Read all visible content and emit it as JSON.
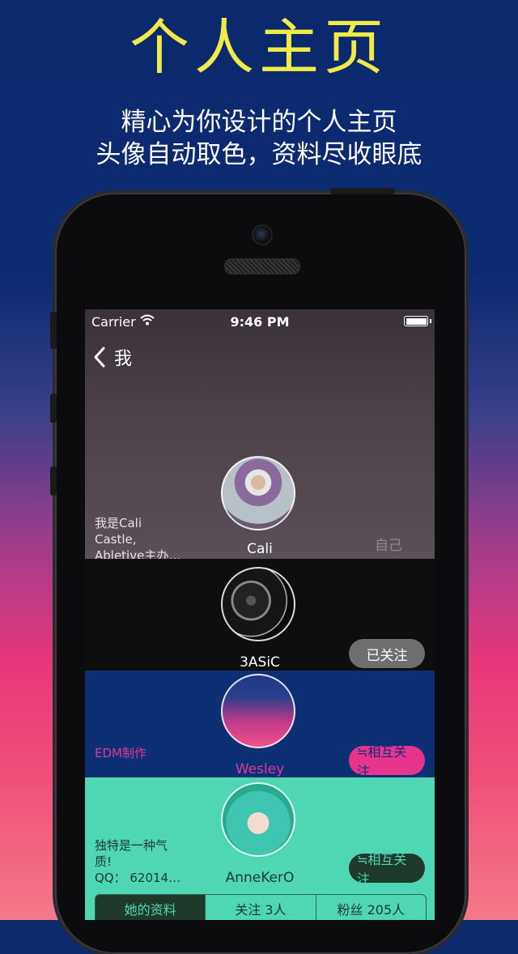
{
  "promo": {
    "title": "个人主页",
    "subtitle_line1": "精心为你设计的个人主页",
    "subtitle_line2": "头像自动取色，资料尽收眼底"
  },
  "status_bar": {
    "carrier": "Carrier",
    "time": "9:46 PM"
  },
  "nav": {
    "back_label": "我"
  },
  "users": [
    {
      "name": "Cali",
      "bio": [
        "我是Cali",
        "Castle,",
        "Abletive主办…"
      ],
      "action_label": "自己",
      "colors": {
        "bg": "#5a5058",
        "name": "#ffffff",
        "bio": "#e8e0e6"
      }
    },
    {
      "name": "3ASiC",
      "bio": [],
      "action_label": "已关注",
      "colors": {
        "bg": "#0e0e0e",
        "name": "#ffffff",
        "button_bg": "#6e6e6e",
        "button_text": "#ffffff"
      }
    },
    {
      "name": "Wesley",
      "bio": [
        "EDM制作"
      ],
      "action_label": "≒相互关注",
      "colors": {
        "bg": "#0d2f74",
        "name": "#e0399a",
        "bio": "#e0399a",
        "button_bg": "#e8358c",
        "button_text": "#0d2f74"
      }
    },
    {
      "name": "AnneKerO",
      "bio": [
        "独特是一种气",
        "质!",
        "QQ：  62014…"
      ],
      "action_label": "≒相互关注",
      "colors": {
        "bg": "#4fd7b4",
        "name": "#1f3a30",
        "bio": "#1f3a30",
        "button_bg": "#1f3a2a",
        "button_text": "#4fd7b4"
      }
    }
  ],
  "tabs": [
    "她的资料",
    "关注 3人",
    "粉丝 205人"
  ],
  "icons": [
    "wifi-icon",
    "battery-icon",
    "back-chevron-icon"
  ]
}
